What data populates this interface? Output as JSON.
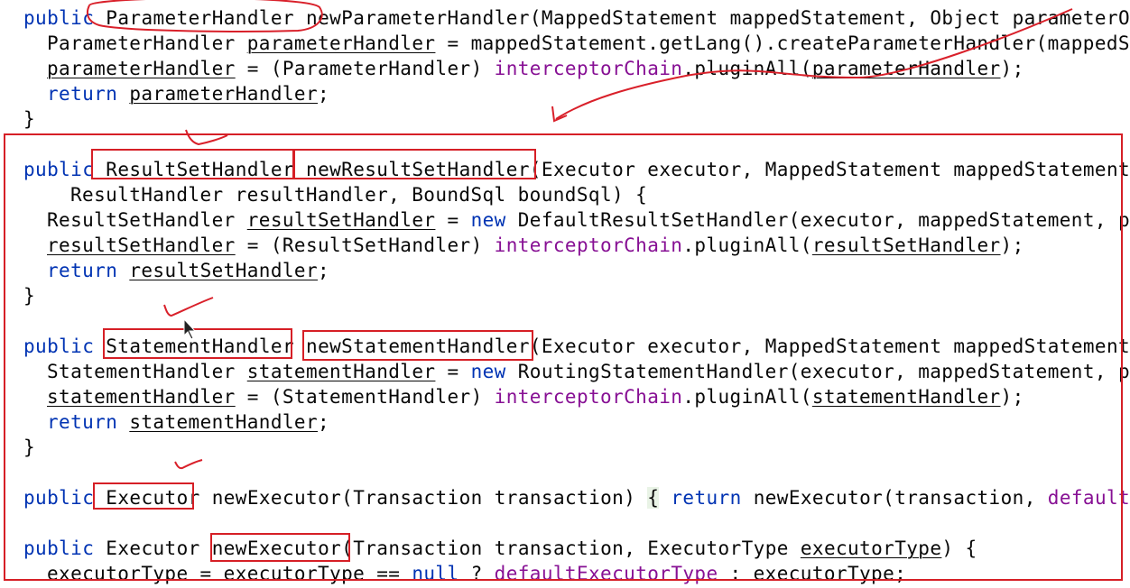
{
  "editor": {
    "lines": [
      {
        "indent": 1,
        "tokens": [
          {
            "t": "public",
            "k": "kw"
          },
          {
            "t": " ParameterHandler newParameterHandler(MappedStatement mappedStatement, Object parameterObject, BoundSql boundSql) {"
          }
        ]
      },
      {
        "indent": 2,
        "tokens": [
          {
            "t": "ParameterHandler "
          },
          {
            "t": "parameterHandler",
            "u": true
          },
          {
            "t": " = mappedStatement.getLang().createParameterHandler(mappedStatement, parameterObject, boundSql);"
          }
        ]
      },
      {
        "indent": 2,
        "tokens": [
          {
            "t": "parameterHandler",
            "u": true
          },
          {
            "t": " = (ParameterHandler) "
          },
          {
            "t": "interceptorChain",
            "k": "field"
          },
          {
            "t": ".pluginAll("
          },
          {
            "t": "parameterHandler",
            "u": true
          },
          {
            "t": ");"
          }
        ]
      },
      {
        "indent": 2,
        "tokens": [
          {
            "t": "return",
            "k": "kw"
          },
          {
            "t": " "
          },
          {
            "t": "parameterHandler",
            "u": true
          },
          {
            "t": ";"
          }
        ]
      },
      {
        "indent": 1,
        "tokens": [
          {
            "t": "}"
          }
        ]
      },
      {
        "indent": 0,
        "tokens": []
      },
      {
        "indent": 1,
        "tokens": [
          {
            "t": "public",
            "k": "kw"
          },
          {
            "t": " ResultSetHandler newResultSetHandler(Executor executor, MappedStatement mappedStatement, RowBounds rowBounds, ParameterHandler parameterHandler,"
          }
        ]
      },
      {
        "indent": 3,
        "tokens": [
          {
            "t": "ResultHandler resultHandler, BoundSql boundSql) {"
          }
        ]
      },
      {
        "indent": 2,
        "tokens": [
          {
            "t": "ResultSetHandler "
          },
          {
            "t": "resultSetHandler",
            "u": true
          },
          {
            "t": " = "
          },
          {
            "t": "new",
            "k": "kw"
          },
          {
            "t": " DefaultResultSetHandler(executor, mappedStatement, parameterHandler, resultHandler, boundSql, rowBounds);"
          }
        ]
      },
      {
        "indent": 2,
        "tokens": [
          {
            "t": "resultSetHandler",
            "u": true
          },
          {
            "t": " = (ResultSetHandler) "
          },
          {
            "t": "interceptorChain",
            "k": "field"
          },
          {
            "t": ".pluginAll("
          },
          {
            "t": "resultSetHandler",
            "u": true
          },
          {
            "t": ");"
          }
        ]
      },
      {
        "indent": 2,
        "tokens": [
          {
            "t": "return",
            "k": "kw"
          },
          {
            "t": " "
          },
          {
            "t": "resultSetHandler",
            "u": true
          },
          {
            "t": ";"
          }
        ]
      },
      {
        "indent": 1,
        "tokens": [
          {
            "t": "}"
          }
        ]
      },
      {
        "indent": 0,
        "tokens": []
      },
      {
        "indent": 1,
        "tokens": [
          {
            "t": "public",
            "k": "kw"
          },
          {
            "t": " StatementHandler newStatementHandler(Executor executor, MappedStatement mappedStatement, Object parameterObject, RowBounds rowBounds, ResultHandler resultHandler, BoundSql boundSql) {"
          }
        ]
      },
      {
        "indent": 2,
        "tokens": [
          {
            "t": "StatementHandler "
          },
          {
            "t": "statementHandler",
            "u": true
          },
          {
            "t": " = "
          },
          {
            "t": "new",
            "k": "kw"
          },
          {
            "t": " RoutingStatementHandler(executor, mappedStatement, parameterObject, rowBounds, resultHandler, boundSql);"
          }
        ]
      },
      {
        "indent": 2,
        "tokens": [
          {
            "t": "statementHandler",
            "u": true
          },
          {
            "t": " = (StatementHandler) "
          },
          {
            "t": "interceptorChain",
            "k": "field"
          },
          {
            "t": ".pluginAll("
          },
          {
            "t": "statementHandler",
            "u": true
          },
          {
            "t": ");"
          }
        ]
      },
      {
        "indent": 2,
        "tokens": [
          {
            "t": "return",
            "k": "kw"
          },
          {
            "t": " "
          },
          {
            "t": "statementHandler",
            "u": true
          },
          {
            "t": ";"
          }
        ]
      },
      {
        "indent": 1,
        "tokens": [
          {
            "t": "}"
          }
        ]
      },
      {
        "indent": 0,
        "tokens": []
      },
      {
        "indent": 1,
        "tokens": [
          {
            "t": "public",
            "k": "kw"
          },
          {
            "t": " Executor newExecutor(Transaction transaction) "
          },
          {
            "t": "{",
            "hl": true
          },
          {
            "t": " "
          },
          {
            "t": "return",
            "k": "kw"
          },
          {
            "t": " newExecutor(transaction, "
          },
          {
            "t": "defaultExecutorType",
            "k": "field"
          },
          {
            "t": "); }"
          }
        ]
      },
      {
        "indent": 0,
        "tokens": []
      },
      {
        "indent": 1,
        "tokens": [
          {
            "t": "public",
            "k": "kw"
          },
          {
            "t": " Executor newExecutor(Transaction transaction, ExecutorType "
          },
          {
            "t": "executorType",
            "u": true
          },
          {
            "t": ") {"
          }
        ]
      },
      {
        "indent": 2,
        "tokens": [
          {
            "t": "executorType = executorType == "
          },
          {
            "t": "null",
            "k": "kw"
          },
          {
            "t": " ? "
          },
          {
            "t": "defaultExecutorType",
            "k": "field"
          },
          {
            "t": " : executorType;"
          }
        ]
      }
    ]
  },
  "annotations": {
    "ink_color": "#d9202a",
    "box_color": "#d61f26"
  }
}
